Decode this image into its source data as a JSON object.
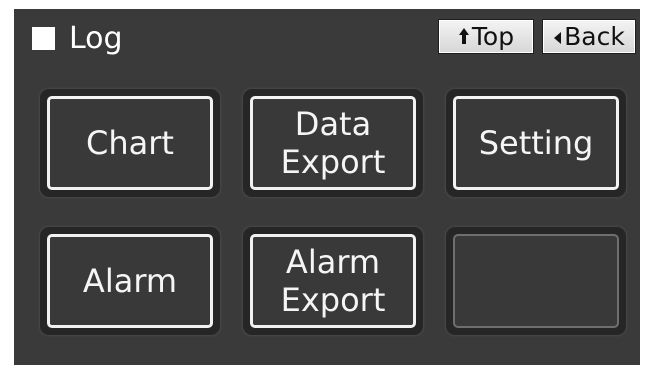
{
  "header": {
    "icon": "square-log-icon",
    "title": "Log"
  },
  "nav": {
    "top_label": "Top",
    "top_icon": "arrow-up-icon",
    "back_label": "Back",
    "back_icon": "triangle-left-icon"
  },
  "tiles": {
    "chart": {
      "line1": "Chart"
    },
    "data_export": {
      "line1": "Data",
      "line2": "Export"
    },
    "setting": {
      "line1": "Setting"
    },
    "alarm": {
      "line1": "Alarm"
    },
    "alarm_export": {
      "line1": "Alarm",
      "line2": "Export"
    }
  },
  "colors": {
    "screen_bg": "#3a3a3a",
    "tile_border": "#f2f2f2",
    "nav_button_bg": "#e6e6e6",
    "text": "#ffffff"
  }
}
